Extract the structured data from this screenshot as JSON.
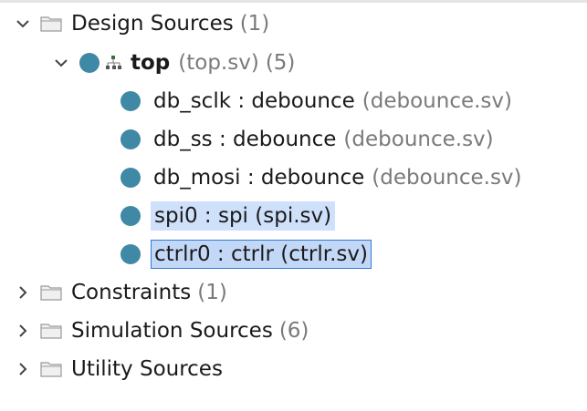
{
  "tree": {
    "design_sources": {
      "label": "Design Sources",
      "count": "(1)"
    },
    "top": {
      "name": "top",
      "file": "(top.sv)",
      "count": "(5)"
    },
    "children": [
      {
        "name": "db_sclk : debounce",
        "file": "(debounce.sv)"
      },
      {
        "name": "db_ss : debounce",
        "file": "(debounce.sv)"
      },
      {
        "name": "db_mosi : debounce",
        "file": "(debounce.sv)"
      },
      {
        "name": "spi0 : spi (spi.sv)"
      },
      {
        "name": "ctrlr0 : ctrlr (ctrlr.sv)"
      }
    ],
    "constraints": {
      "label": "Constraints",
      "count": "(1)"
    },
    "simulation_sources": {
      "label": "Simulation Sources",
      "count": "(6)"
    },
    "utility_sources": {
      "label": "Utility Sources"
    }
  },
  "colors": {
    "module_dot": "#3f88a6",
    "selection_bg": "#c3d8f7",
    "selection_border": "#2f7bd6"
  },
  "icons": {
    "expanded": "chevron-down-icon",
    "collapsed": "chevron-right-icon",
    "folder": "folder-icon",
    "module": "module-dot-icon",
    "hierarchy": "hierarchy-icon"
  }
}
